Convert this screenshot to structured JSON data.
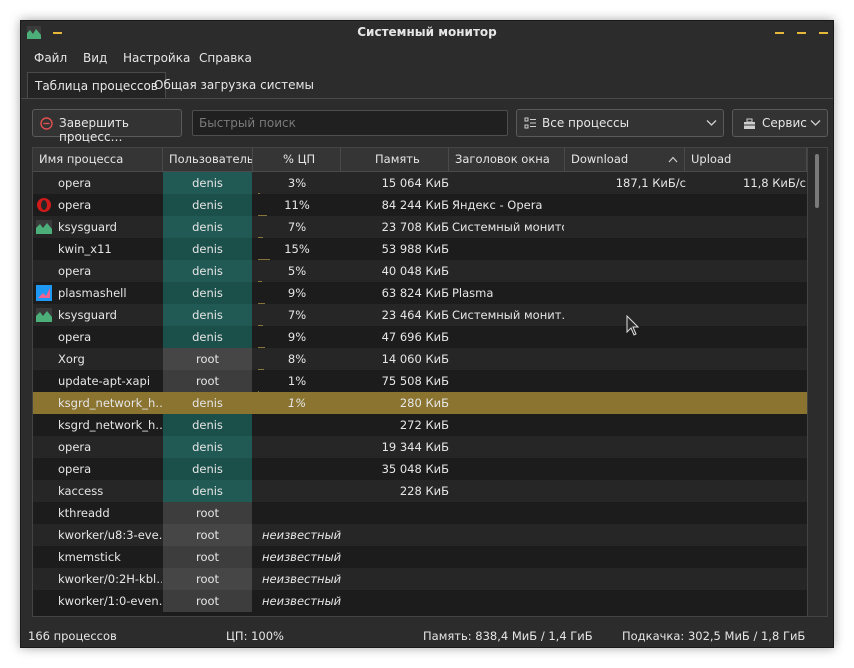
{
  "window": {
    "title": "Системный монитор"
  },
  "menu": [
    "Файл",
    "Вид",
    "Настройка",
    "Справка"
  ],
  "tabs": [
    {
      "label": "Таблица процессов",
      "active": true
    },
    {
      "label": "Общая загрузка системы",
      "active": false
    }
  ],
  "toolbar": {
    "kill_label": "Завершить процесс…",
    "search_placeholder": "Быстрый поиск",
    "filter_label": "Все процессы",
    "tools_label": "Сервис"
  },
  "columns": [
    "Имя процесса",
    "Пользователь",
    "% ЦП",
    "Память",
    "Заголовок окна",
    "Download",
    "Upload"
  ],
  "rows": [
    {
      "icon": "none",
      "name": "opera",
      "user": "denis",
      "cpu": "3%",
      "mem": "15 064 КиБ",
      "title": "",
      "dl": "187,1 КиБ/с",
      "ul": "11,8 КиБ/с"
    },
    {
      "icon": "opera-icon",
      "name": "opera",
      "user": "denis",
      "cpu": "11%",
      "mem": "84 244 КиБ",
      "title": "Яндекс - Opera",
      "dl": "",
      "ul": ""
    },
    {
      "icon": "ksysguard-icon",
      "name": "ksysguard",
      "user": "denis",
      "cpu": "7%",
      "mem": "23 708 КиБ",
      "title": "Системный монитор",
      "dl": "",
      "ul": ""
    },
    {
      "icon": "none",
      "name": "kwin_x11",
      "user": "denis",
      "cpu": "15%",
      "mem": "53 988 КиБ",
      "title": "",
      "dl": "",
      "ul": ""
    },
    {
      "icon": "none",
      "name": "opera",
      "user": "denis",
      "cpu": "5%",
      "mem": "40 048 КиБ",
      "title": "",
      "dl": "",
      "ul": ""
    },
    {
      "icon": "plasma-icon",
      "name": "plasmashell",
      "user": "denis",
      "cpu": "9%",
      "mem": "63 824 КиБ",
      "title": "Plasma",
      "dl": "",
      "ul": ""
    },
    {
      "icon": "ksysguard-icon",
      "name": "ksysguard",
      "user": "denis",
      "cpu": "7%",
      "mem": "23 464 КиБ",
      "title": "Системный монит…",
      "dl": "",
      "ul": ""
    },
    {
      "icon": "none",
      "name": "opera",
      "user": "denis",
      "cpu": "9%",
      "mem": "47 696 КиБ",
      "title": "",
      "dl": "",
      "ul": ""
    },
    {
      "icon": "none",
      "name": "Xorg",
      "user": "root",
      "cpu": "8%",
      "mem": "14 060 КиБ",
      "title": "",
      "dl": "",
      "ul": ""
    },
    {
      "icon": "none",
      "name": "update-apt-xapi",
      "user": "root",
      "cpu": "1%",
      "mem": "75 508 КиБ",
      "title": "",
      "dl": "",
      "ul": ""
    },
    {
      "icon": "none",
      "name": "ksgrd_network_h…",
      "user": "denis",
      "cpu": "1%",
      "mem": "280 КиБ",
      "title": "",
      "dl": "",
      "ul": "",
      "highlight": true
    },
    {
      "icon": "none",
      "name": "ksgrd_network_h…",
      "user": "denis",
      "cpu": "",
      "mem": "272 КиБ",
      "title": "",
      "dl": "",
      "ul": ""
    },
    {
      "icon": "none",
      "name": "opera",
      "user": "denis",
      "cpu": "",
      "mem": "19 344 КиБ",
      "title": "",
      "dl": "",
      "ul": ""
    },
    {
      "icon": "none",
      "name": "opera",
      "user": "denis",
      "cpu": "",
      "mem": "35 048 КиБ",
      "title": "",
      "dl": "",
      "ul": ""
    },
    {
      "icon": "none",
      "name": "kaccess",
      "user": "denis",
      "cpu": "",
      "mem": "228 КиБ",
      "title": "",
      "dl": "",
      "ul": ""
    },
    {
      "icon": "none",
      "name": "kthreadd",
      "user": "root",
      "cpu": "",
      "mem": "",
      "title": "",
      "dl": "",
      "ul": ""
    },
    {
      "icon": "none",
      "name": "kworker/u8:3-eve…",
      "user": "root",
      "cpu": "неизвестный",
      "mem": "",
      "title": "",
      "dl": "",
      "ul": ""
    },
    {
      "icon": "none",
      "name": "kmemstick",
      "user": "root",
      "cpu": "неизвестный",
      "mem": "",
      "title": "",
      "dl": "",
      "ul": ""
    },
    {
      "icon": "none",
      "name": "kworker/0:2H-kbl…",
      "user": "root",
      "cpu": "неизвестный",
      "mem": "",
      "title": "",
      "dl": "",
      "ul": ""
    },
    {
      "icon": "none",
      "name": "kworker/1:0-even…",
      "user": "root",
      "cpu": "неизвестный",
      "mem": "",
      "title": "",
      "dl": "",
      "ul": ""
    }
  ],
  "status": {
    "processes": "166 процессов",
    "cpu": "ЦП: 100%",
    "memory": "Память: 838,4 МиБ / 1,4 ГиБ",
    "swap": "Подкачка: 302,5 МиБ / 1,8 ГиБ"
  },
  "colors": {
    "accent": "#e5b73b",
    "highlight_row": "#8a7430",
    "user_denis": "#1b4f4a"
  }
}
